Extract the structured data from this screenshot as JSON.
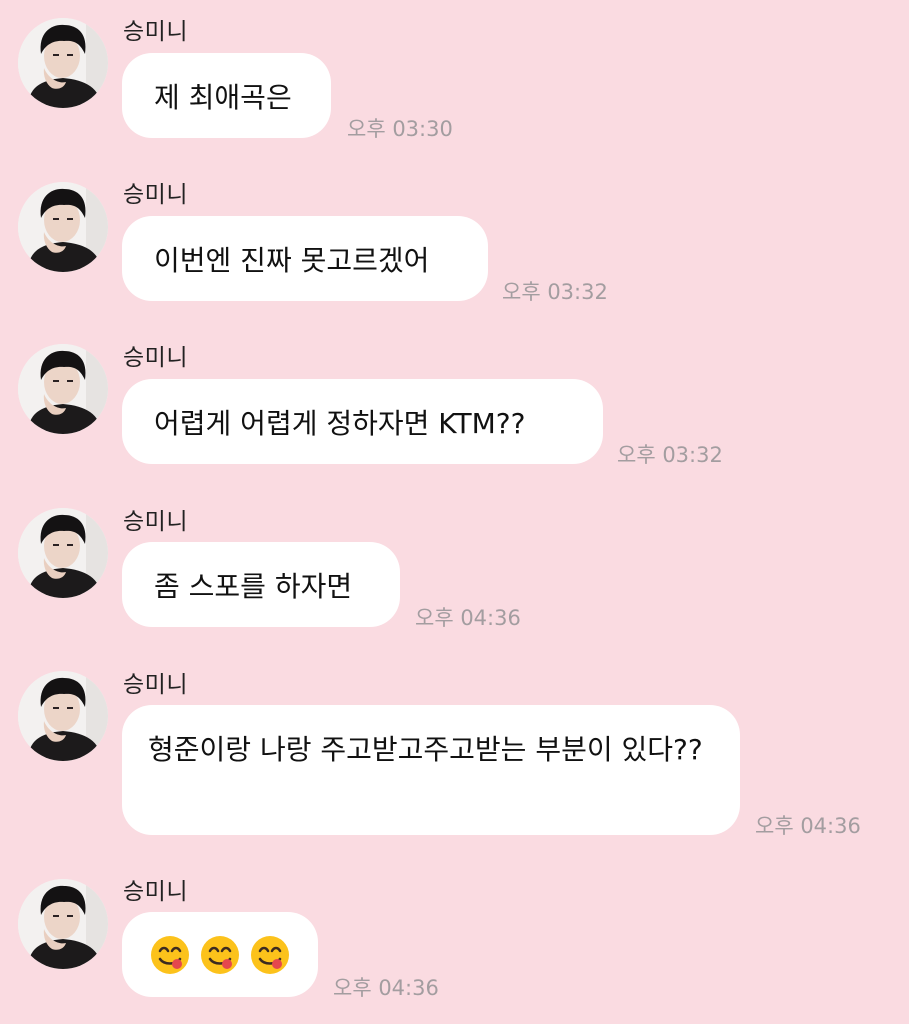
{
  "chat": {
    "messages": [
      {
        "sender": "승미니",
        "text": "제 최애곡은",
        "time": "오후 03:30"
      },
      {
        "sender": "승미니",
        "text": "이번엔 진짜 못고르겠어",
        "time": "오후 03:32"
      },
      {
        "sender": "승미니",
        "text": "어렵게 어렵게 정하자면 KTM??",
        "time": "오후 03:32"
      },
      {
        "sender": "승미니",
        "text": "좀 스포를 하자면",
        "time": "오후 04:36"
      },
      {
        "sender": "승미니",
        "text": "형준이랑 나랑 주고받고주고받는 부분이 있다??",
        "time": "오후 04:36"
      },
      {
        "sender": "승미니",
        "text": "😋😋😋",
        "time": "오후 04:36"
      }
    ]
  },
  "icons": {
    "emoji": "yum-face-icon"
  },
  "colors": {
    "background": "#fadbe1",
    "bubble": "#ffffff",
    "timestamp": "#a39da0"
  }
}
